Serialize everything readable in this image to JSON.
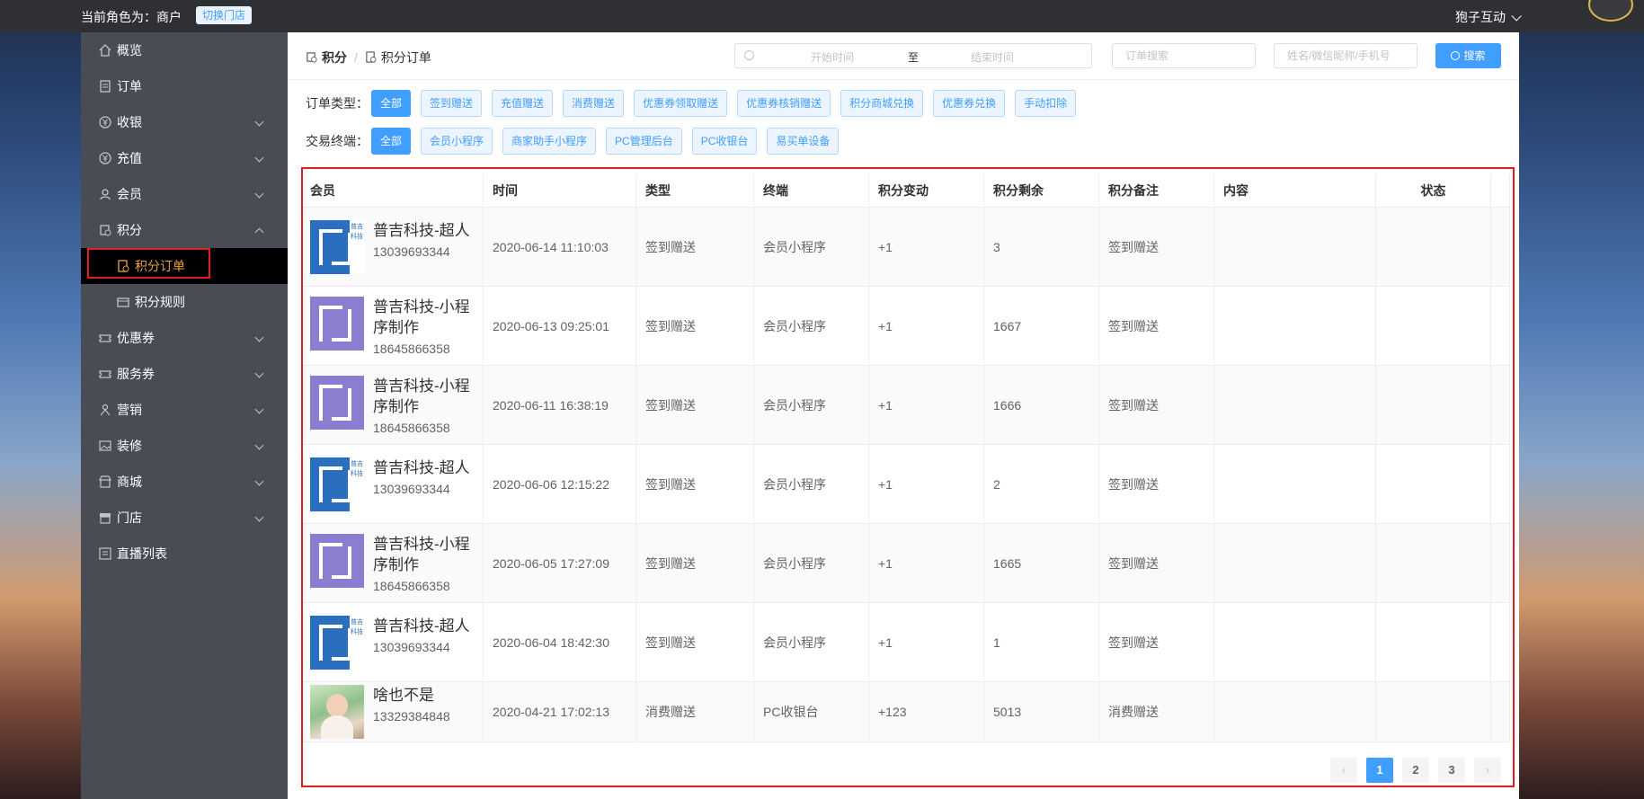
{
  "topbar": {
    "role_text": "当前角色为：商户",
    "switch_store": "切换门店",
    "user_name": "狍子互动"
  },
  "sidebar": {
    "items": [
      {
        "label": "概览"
      },
      {
        "label": "订单"
      },
      {
        "label": "收银"
      },
      {
        "label": "充值"
      },
      {
        "label": "会员"
      },
      {
        "label": "积分"
      },
      {
        "label": "优惠券"
      },
      {
        "label": "服务券"
      },
      {
        "label": "营销"
      },
      {
        "label": "装修"
      },
      {
        "label": "商城"
      },
      {
        "label": "门店"
      },
      {
        "label": "直播列表"
      }
    ],
    "sub_items": [
      {
        "label": "积分订单"
      },
      {
        "label": "积分规则"
      }
    ]
  },
  "header": {
    "breadcrumb_1": "积分",
    "breadcrumb_sep": "/",
    "breadcrumb_2": "积分订单",
    "start_placeholder": "开始时间",
    "range_separator": "至",
    "end_placeholder": "结束时间",
    "order_search_placeholder": "订单搜索",
    "name_search_placeholder": "姓名/微信昵称/手机号",
    "search_button": "搜索"
  },
  "filters": {
    "order_type_label": "订单类型：",
    "order_types": [
      "全部",
      "签到赠送",
      "充值赠送",
      "消费赠送",
      "优惠券领取赠送",
      "优惠券核销赠送",
      "积分商城兑换",
      "优惠券兑换",
      "手动扣除"
    ],
    "terminal_label": "交易终端：",
    "terminals": [
      "全部",
      "会员小程序",
      "商家助手小程序",
      "PC管理后台",
      "PC收银台",
      "易买单设备"
    ]
  },
  "table": {
    "headers": [
      "会员",
      "时间",
      "类型",
      "终端",
      "积分变动",
      "积分剩余",
      "积分备注",
      "内容",
      "状态"
    ],
    "rows": [
      {
        "name": "普吉科技-超人",
        "phone": "13039693344",
        "time": "2020-06-14 11:10:03",
        "type": "签到赠送",
        "terminal": "会员小程序",
        "change": "+1",
        "remain": "3",
        "note": "签到赠送",
        "content": "",
        "status": ""
      },
      {
        "name": "普吉科技-小程序制作",
        "phone": "18645866358",
        "time": "2020-06-13 09:25:01",
        "type": "签到赠送",
        "terminal": "会员小程序",
        "change": "+1",
        "remain": "1667",
        "note": "签到赠送",
        "content": "",
        "status": ""
      },
      {
        "name": "普吉科技-小程序制作",
        "phone": "18645866358",
        "time": "2020-06-11 16:38:19",
        "type": "签到赠送",
        "terminal": "会员小程序",
        "change": "+1",
        "remain": "1666",
        "note": "签到赠送",
        "content": "",
        "status": ""
      },
      {
        "name": "普吉科技-超人",
        "phone": "13039693344",
        "time": "2020-06-06 12:15:22",
        "type": "签到赠送",
        "terminal": "会员小程序",
        "change": "+1",
        "remain": "2",
        "note": "签到赠送",
        "content": "",
        "status": ""
      },
      {
        "name": "普吉科技-小程序制作",
        "phone": "18645866358",
        "time": "2020-06-05 17:27:09",
        "type": "签到赠送",
        "terminal": "会员小程序",
        "change": "+1",
        "remain": "1665",
        "note": "签到赠送",
        "content": "",
        "status": ""
      },
      {
        "name": "普吉科技-超人",
        "phone": "13039693344",
        "time": "2020-06-04 18:42:30",
        "type": "签到赠送",
        "terminal": "会员小程序",
        "change": "+1",
        "remain": "1",
        "note": "签到赠送",
        "content": "",
        "status": ""
      },
      {
        "name": "啥也不是",
        "phone": "13329384848",
        "time": "2020-04-21 17:02:13",
        "type": "消费赠送",
        "terminal": "PC收银台",
        "change": "+123",
        "remain": "5013",
        "note": "消费赠送",
        "content": "",
        "status": ""
      }
    ]
  },
  "avatar_logo_text": "普吉科技",
  "pagination": {
    "pages": [
      "1",
      "2",
      "3"
    ],
    "current": "1",
    "prev": "‹",
    "next": "›"
  },
  "colors": {
    "primary": "#409eff",
    "sidebar_bg": "#494c54",
    "active_menu": "#e6a23c",
    "highlight_border": "#e02020"
  }
}
